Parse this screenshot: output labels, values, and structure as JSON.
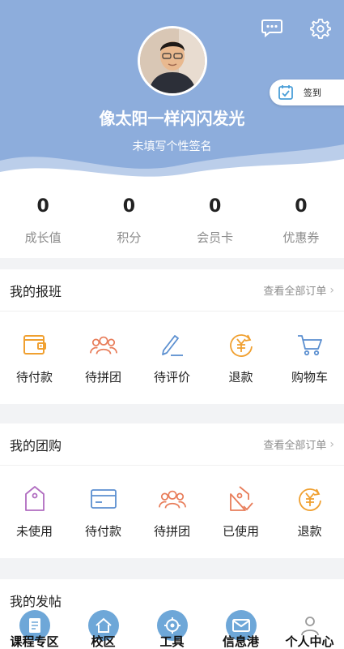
{
  "header": {
    "username": "像太阳一样闪闪发光",
    "signature": "未填写个性签名",
    "checkin_label": "签到",
    "icons": [
      "chat-bubble-icon",
      "gear-icon"
    ]
  },
  "stats": [
    {
      "value": "0",
      "label": "成长值"
    },
    {
      "value": "0",
      "label": "积分"
    },
    {
      "value": "0",
      "label": "会员卡"
    },
    {
      "value": "0",
      "label": "优惠券"
    }
  ],
  "my_classes": {
    "title": "我的报班",
    "link": "查看全部订单",
    "items": [
      {
        "label": "待付款",
        "icon": "wallet-icon"
      },
      {
        "label": "待拼团",
        "icon": "group-icon"
      },
      {
        "label": "待评价",
        "icon": "pen-icon"
      },
      {
        "label": "退款",
        "icon": "refund-icon"
      },
      {
        "label": "购物车",
        "icon": "cart-icon"
      }
    ]
  },
  "my_group_buy": {
    "title": "我的团购",
    "link": "查看全部订单",
    "items": [
      {
        "label": "未使用",
        "icon": "tag-icon"
      },
      {
        "label": "待付款",
        "icon": "card-icon"
      },
      {
        "label": "待拼团",
        "icon": "group-icon"
      },
      {
        "label": "已使用",
        "icon": "tag-check-icon"
      },
      {
        "label": "退款",
        "icon": "refund-icon"
      }
    ]
  },
  "my_posts": {
    "title": "我的发帖"
  },
  "bottom_nav": [
    {
      "label": "课程专区",
      "icon": "document-icon"
    },
    {
      "label": "校区",
      "icon": "home-icon"
    },
    {
      "label": "工具",
      "icon": "target-icon"
    },
    {
      "label": "信息港",
      "icon": "envelope-icon"
    },
    {
      "label": "个人中心",
      "icon": "person-icon"
    }
  ],
  "colors": {
    "header_bg": "#8daddc",
    "orange": "#f0a030",
    "coral": "#e87d5a",
    "blue": "#5b8fd0",
    "purple": "#b06cc0",
    "nav_circle": "#6ea7d8"
  }
}
